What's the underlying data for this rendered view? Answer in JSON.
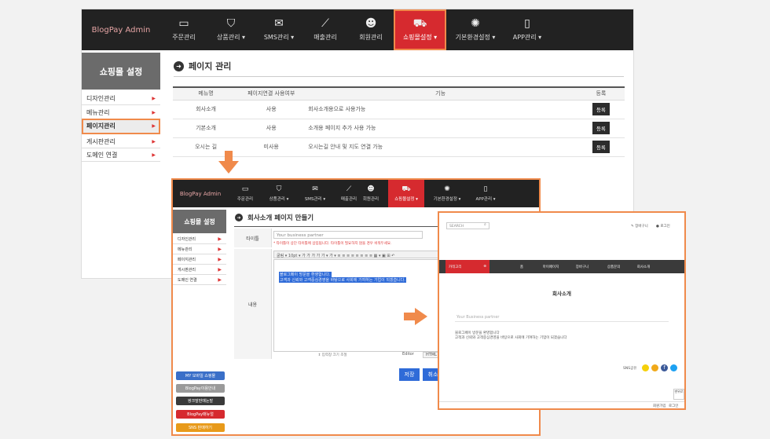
{
  "main": {
    "brand": "BlogPay Admin",
    "nav": [
      {
        "label": "주문관리",
        "icon": "monitor-icon"
      },
      {
        "label": "상품관리 ▾",
        "icon": "basket-icon"
      },
      {
        "label": "SMS관리 ▾",
        "icon": "chat-icon"
      },
      {
        "label": "매출관리",
        "icon": "chart-icon"
      },
      {
        "label": "회원관리",
        "icon": "people-icon"
      },
      {
        "label": "쇼핑몰설정 ▾",
        "icon": "cart-icon"
      },
      {
        "label": "기본환경설정 ▾",
        "icon": "gear-icon"
      },
      {
        "label": "APP관리 ▾",
        "icon": "phone-icon"
      }
    ],
    "sidebar_title": "쇼핑몰 설정",
    "sidebar": [
      "디자인관리",
      "메뉴관리",
      "페이지관리",
      "게시판관리",
      "도메인 연결"
    ],
    "page_title": "페이지 관리",
    "table": {
      "headers": [
        "메뉴명",
        "페이지연결 사용여부",
        "기능",
        "등록"
      ],
      "rows": [
        {
          "menu": "회사소개",
          "use": "사용",
          "feature": "회사소개용으로 사용가능",
          "btn": "등록"
        },
        {
          "menu": "기본소개",
          "use": "사용",
          "feature": "소개용 페이지 추가 사용 가능",
          "btn": "등록"
        },
        {
          "menu": "오시는 길",
          "use": "미사용",
          "feature": "오시는길 안내 및 지도 연결 가능",
          "btn": "등록"
        }
      ]
    }
  },
  "editor": {
    "brand": "BlogPay Admin",
    "nav": [
      "주문관리",
      "상품관리 ▾",
      "SMS관리 ▾",
      "매출관리",
      "회원관리",
      "쇼핑몰설정 ▾",
      "기본환경설정 ▾",
      "APP관리 ▾"
    ],
    "sidebar_title": "쇼핑몰 설정",
    "sidebar": [
      "디자인관리",
      "메뉴관리",
      "페이지관리",
      "게시판관리",
      "도메인 연결"
    ],
    "page_title": "회사소개 페이지 만들기",
    "title_label": "타이틀",
    "title_value": "Your business partner",
    "title_warn": "* 타이틀이 상단 타이틀에 삽입됩니다. 타이틀이 필요하지 않을 경우 비워두세요.",
    "content_label": "내용",
    "toolbar": "굴림 ▾ 10pt ▾ 가 가 가 가 가 ▾ 가 ▾ ≡ ≡ ≡ ≡ ≡ ≡ ≡ ≡ ▦ ▾ ▣ ⊞ ↶",
    "selected_line1": "블로그페이 방문을 환영합니다.",
    "selected_line2": "고객과 신뢰와 고객중심경영을 바탕으로 사회에 기여하는 기업이 되겠습니다.",
    "mode_editor": "Editor",
    "mode_html": "HTML",
    "resize_hint": "⇕ 입력창 크기 조절",
    "save_btn": "저장",
    "cancel_btn": "취소",
    "side_buttons": [
      "MY 모바일 쇼핑몰",
      "BlogPay이용안내",
      "쌍크말판매눈말",
      "BlogPay매뉴얼",
      "SNS 판매하기"
    ]
  },
  "preview": {
    "search": "SEARCH",
    "link1": "장바구니",
    "link2": "로그인",
    "nav": [
      "카테고리",
      "홈",
      "마이페이지",
      "장바구니",
      "상품문의",
      "회사소개"
    ],
    "heading": "회사소개",
    "partner": "Your Business partner",
    "line1": "블로그페이 방문을 환영합니다",
    "line2": "고객과 신뢰와 고객중심경영을 바탕으로 사회에 기여하는 기업이 되겠습니다",
    "sns_label": "SNS공유",
    "top_btn": "맨위로",
    "footer1": "회원가입",
    "footer2": "로그인"
  },
  "colors": {
    "accent": "#d62a2f",
    "highlight": "#f08a4b",
    "blue": "#2f6bd8"
  }
}
